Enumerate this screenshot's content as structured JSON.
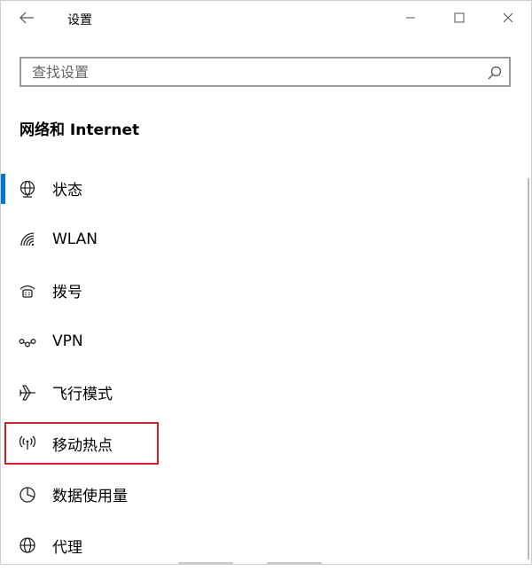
{
  "window": {
    "title": "设置"
  },
  "search": {
    "placeholder": "查找设置",
    "value": ""
  },
  "section": {
    "title": "网络和 Internet"
  },
  "nav": {
    "selected_index": 0,
    "highlighted_index": 5,
    "items": [
      {
        "label": "状态",
        "icon": "globe-status-icon"
      },
      {
        "label": "WLAN",
        "icon": "wifi-icon"
      },
      {
        "label": "拨号",
        "icon": "dial-up-icon"
      },
      {
        "label": "VPN",
        "icon": "vpn-icon"
      },
      {
        "label": "飞行模式",
        "icon": "airplane-icon"
      },
      {
        "label": "移动热点",
        "icon": "hotspot-icon"
      },
      {
        "label": "数据使用量",
        "icon": "data-usage-icon"
      },
      {
        "label": "代理",
        "icon": "globe-proxy-icon"
      }
    ]
  },
  "colors": {
    "accent": "#0078d7",
    "highlight_border": "#d0202c",
    "search_border": "#9a9a9a"
  }
}
